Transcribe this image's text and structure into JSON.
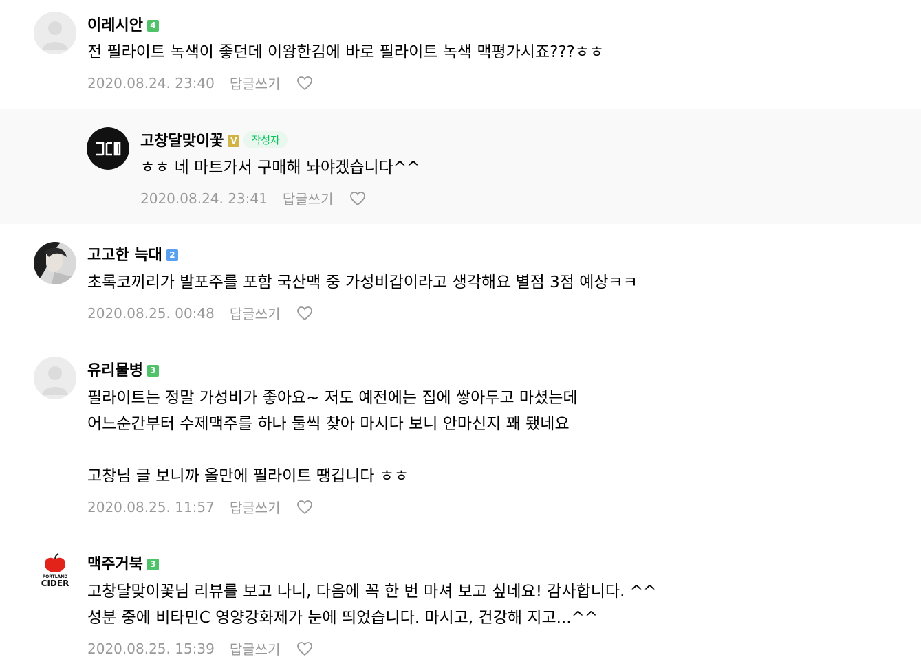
{
  "reply_label": "답글쓰기",
  "author_badge": "작성자",
  "comments": [
    {
      "nickname": "이레시안",
      "level": "4",
      "text": [
        "전 필라이트 녹색이 좋던데 이왕한김에 바로 필라이트 녹색 맥평가시죠???ㅎㅎ"
      ],
      "date": "2020.08.24. 23:40"
    },
    {
      "nickname": "고창달맞이꽃",
      "level": "V",
      "is_author": true,
      "avatar_label": "고담",
      "text": [
        "ㅎㅎ 네 마트가서 구매해 놔야겠습니다^^"
      ],
      "date": "2020.08.24. 23:41"
    },
    {
      "nickname": "고고한 늑대",
      "level": "2",
      "text": [
        "초록코끼리가 발포주를 포함 국산맥 중 가성비갑이라고 생각해요 별점 3점 예상ㅋㅋ"
      ],
      "date": "2020.08.25. 00:48"
    },
    {
      "nickname": "유리물병",
      "level": "3",
      "text": [
        "필라이트는 정말 가성비가 좋아요~ 저도 예전에는 집에 쌓아두고 마셨는데",
        "어느순간부터 수제맥주를 하나 둘씩 찾아 마시다 보니 안마신지 꽤 됐네요",
        "",
        "고창님 글 보니까 올만에 필라이트 땡깁니다 ㅎㅎ"
      ],
      "date": "2020.08.25. 11:57"
    },
    {
      "nickname": "맥주거북",
      "level": "3",
      "avatar_label": "PORTLAND CIDER",
      "text": [
        "고창달맞이꽃님 리뷰를 보고 나니, 다음에 꼭 한 번 마셔 보고 싶네요! 감사합니다. ^^",
        "성분 중에 비타민C 영양강화제가 눈에 띄었습니다. 마시고, 건강해 지고...^^"
      ],
      "date": "2020.08.25. 15:39"
    }
  ],
  "colors": {
    "level_green": "#4fc26a",
    "level_blue": "#5aa0f0",
    "level_gold": "#d2b443",
    "author_badge": "#03c75a",
    "meta_gray": "#999999",
    "reply_bg": "#f9f9f9"
  },
  "icons": [
    "default-avatar-icon",
    "heart-icon",
    "cider-logo-icon"
  ]
}
